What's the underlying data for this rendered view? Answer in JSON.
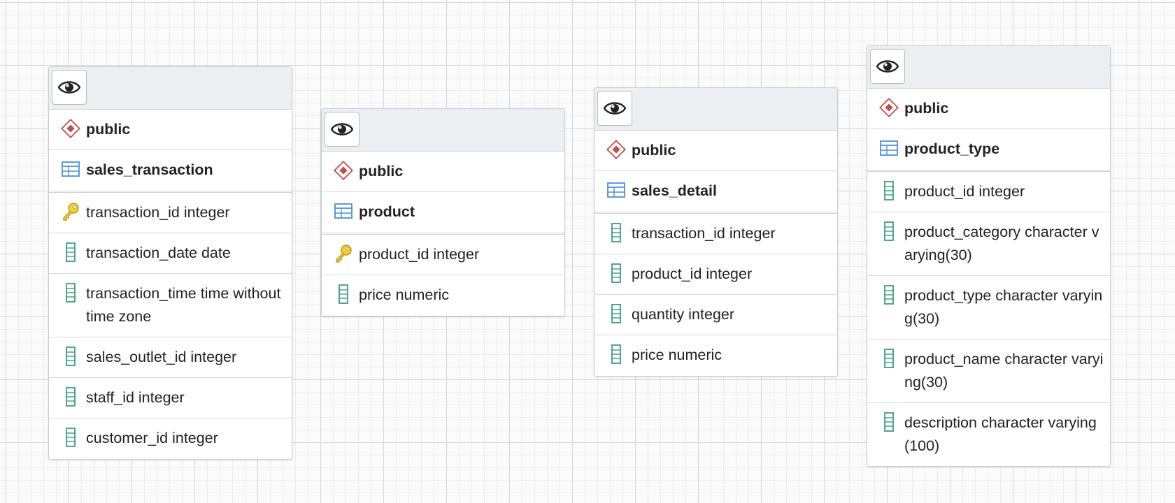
{
  "tables": [
    {
      "schema": "public",
      "name": "sales_transaction",
      "columns": [
        {
          "text": "transaction_id integer",
          "icon": "primary-key-icon"
        },
        {
          "text": "transaction_date date",
          "icon": "column-icon"
        },
        {
          "text": "transaction_time time without time zone",
          "icon": "column-icon"
        },
        {
          "text": "sales_outlet_id integer",
          "icon": "column-icon"
        },
        {
          "text": "staff_id integer",
          "icon": "column-icon"
        },
        {
          "text": "customer_id integer",
          "icon": "column-icon"
        }
      ]
    },
    {
      "schema": "public",
      "name": "product",
      "columns": [
        {
          "text": "product_id integer",
          "icon": "primary-key-icon"
        },
        {
          "text": "price numeric",
          "icon": "column-icon"
        }
      ]
    },
    {
      "schema": "public",
      "name": "sales_detail",
      "columns": [
        {
          "text": "transaction_id integer",
          "icon": "column-icon"
        },
        {
          "text": "product_id integer",
          "icon": "column-icon"
        },
        {
          "text": "quantity integer",
          "icon": "column-icon"
        },
        {
          "text": "price numeric",
          "icon": "column-icon"
        }
      ]
    },
    {
      "schema": "public",
      "name": "product_type",
      "columns": [
        {
          "text": "product_id integer",
          "icon": "column-icon"
        },
        {
          "text": "product_category character varying(30)",
          "icon": "column-icon"
        },
        {
          "text": "product_type character varying(30)",
          "icon": "column-icon"
        },
        {
          "text": "product_name character varying(30)",
          "icon": "column-icon"
        },
        {
          "text": "description character varying(100)",
          "icon": "column-icon"
        }
      ]
    }
  ],
  "colors": {
    "schema_icon": "#c0504d",
    "table_icon": "#4a90d9",
    "column_icon": "#3a9e7e",
    "key_icon": "#e0b92c"
  }
}
